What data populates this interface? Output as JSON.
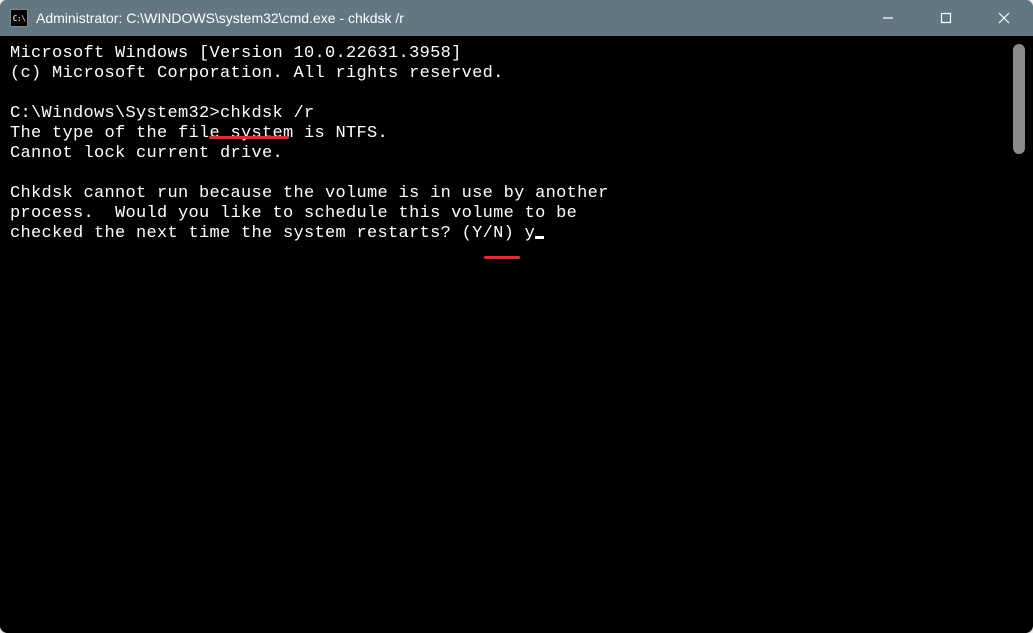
{
  "window": {
    "icon_label": "C:\\",
    "title": "Administrator: C:\\WINDOWS\\system32\\cmd.exe - chkdsk  /r"
  },
  "terminal": {
    "line1": "Microsoft Windows [Version 10.0.22631.3958]",
    "line2": "(c) Microsoft Corporation. All rights reserved.",
    "blank1": "",
    "prompt": "C:\\Windows\\System32>",
    "command": "chkdsk /r",
    "line4": "The type of the file system is NTFS.",
    "line5": "Cannot lock current drive.",
    "blank2": "",
    "line6": "Chkdsk cannot run because the volume is in use by another",
    "line7": "process.  Would you like to schedule this volume to be",
    "line8_prefix": "checked the next time the system restarts? (Y/N) ",
    "user_input": "y"
  }
}
